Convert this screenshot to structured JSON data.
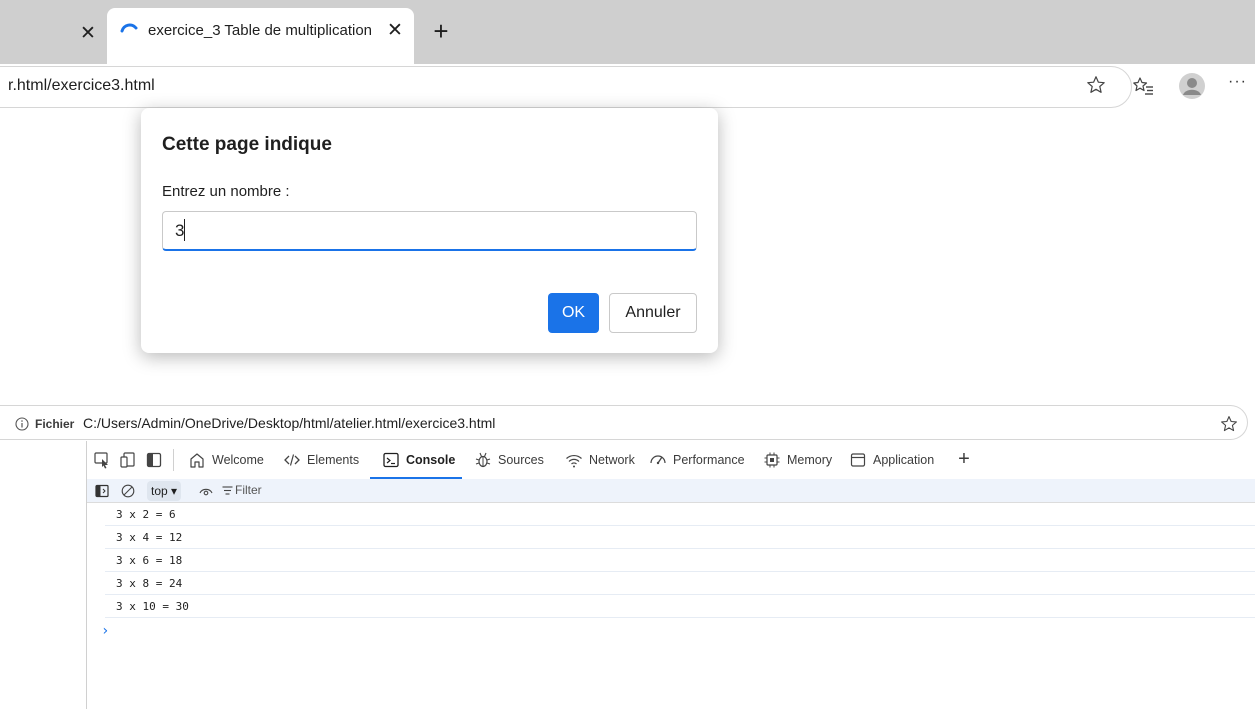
{
  "tabs": {
    "active_title": "exercice_3 Table de multiplication",
    "close_glyph": "✕",
    "new_tab_glyph": "+"
  },
  "toolbar": {
    "address_text": "r.html/exercice3.html",
    "more_glyph": "···"
  },
  "dialog": {
    "title": "Cette page indique",
    "message": "Entrez un nombre :",
    "input_value": "3",
    "ok_label": "OK",
    "cancel_label": "Annuler"
  },
  "devtools_address": {
    "scheme_label": "Fichier",
    "url": "C:/Users/Admin/OneDrive/Desktop/html/atelier.html/exercice3.html"
  },
  "devtools": {
    "tabs": [
      {
        "label": "Welcome",
        "icon": "home-icon",
        "active": false
      },
      {
        "label": "Elements",
        "icon": "code-icon",
        "active": false
      },
      {
        "label": "Console",
        "icon": "console-icon",
        "active": true
      },
      {
        "label": "Sources",
        "icon": "bug-icon",
        "active": false
      },
      {
        "label": "Network",
        "icon": "wifi-icon",
        "active": false
      },
      {
        "label": "Performance",
        "icon": "performance-icon",
        "active": false
      },
      {
        "label": "Memory",
        "icon": "memory-icon",
        "active": false
      },
      {
        "label": "Application",
        "icon": "application-icon",
        "active": false
      }
    ],
    "add_tab_glyph": "+",
    "console_toolbar": {
      "context": "top ▾",
      "filter_label": "Filter"
    },
    "console_lines": [
      "3 x 2 = 6",
      "3 x 4 = 12",
      "3 x 6 = 18",
      "3 x 8 = 24",
      "3 x 10 = 30"
    ],
    "prompt_glyph": "›"
  },
  "colors": {
    "accent": "#1a73e8",
    "tabstrip": "#cfcfcf",
    "console_toolbar_bg": "#eef3fb"
  }
}
